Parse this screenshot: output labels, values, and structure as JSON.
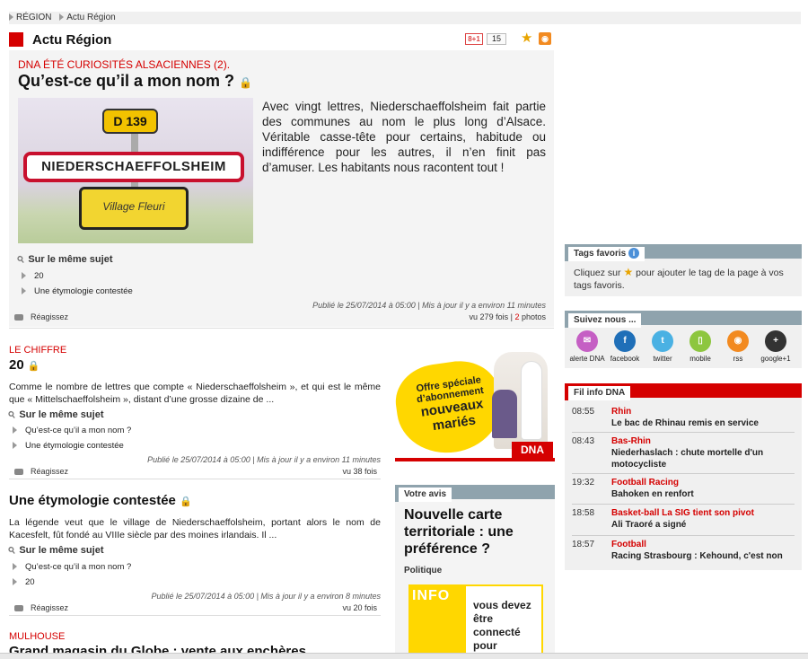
{
  "breadcrumb": {
    "items": [
      "RÉGION",
      "Actu Région"
    ]
  },
  "section": {
    "title": "Actu Région",
    "gplus_label": "8+1",
    "gplus_count": "15"
  },
  "lead": {
    "kicker": "DNA ÉTÉ CURIOSITÉS ALSACIENNES (2).",
    "title": "Qu’est-ce qu’il a mon nom ?",
    "image": {
      "road_number": "D 139",
      "sign_text": "NIEDERSCHAEFFOLSHEIM",
      "village_label": "Village Fleuri"
    },
    "text": "Avec vingt lettres, Niederschaeffolsheim fait partie des communes au nom le plus long d’Alsace. Véritable casse-tête pour certains, habitude ou indifférence pour les autres, il n’en finit pas d’amuser. Les habitants nous racontent tout !",
    "same_topic": "Sur le même sujet",
    "related": [
      "20",
      "Une étymologie contestée"
    ],
    "meta": "Publié le 25/07/2014 à 05:00 | Mis à jour il y a environ 11 minutes",
    "react": "Réagissez",
    "views_prefix": "vu 279 fois |",
    "photos_count": "2",
    "photos_label": "photos"
  },
  "article2": {
    "kicker": "LE CHIFFRE",
    "title": "20",
    "text": "Comme le nombre de lettres que compte « Niederschaeffolsheim », et qui est le même que « Mittelschaeffolsheim », distant d’une grosse dizaine de ...",
    "same_topic": "Sur le même sujet",
    "related": [
      "Qu’est-ce qu’il a mon nom ?",
      "Une étymologie contestée"
    ],
    "meta": "Publié le 25/07/2014 à 05:00 | Mis à jour il y a environ 11 minutes",
    "react": "Réagissez",
    "views": "vu 38 fois"
  },
  "article3": {
    "title": "Une étymologie contestée",
    "text": "La légende veut que le village de Niederschaeffolsheim, portant alors le nom de Kacesfelt, fût fondé au VIIIe siècle par des moines irlandais. Il ...",
    "same_topic": "Sur le même sujet",
    "related": [
      "Qu’est-ce qu’il a mon nom ?",
      "20"
    ],
    "meta": "Publié le 25/07/2014 à 05:00 | Mis à jour il y a environ 8 minutes",
    "react": "Réagissez",
    "views": "vu 20 fois"
  },
  "article4": {
    "kicker": "MULHOUSE",
    "title": "Grand magasin du Globe : vente aux enchères"
  },
  "promo": {
    "line1": "Offre spéciale",
    "line2": "d’abonnement",
    "line3": "nouveaux",
    "line4": "mariés",
    "brand": "DNA"
  },
  "vote": {
    "header": "Votre avis",
    "title": "Nouvelle carte territoriale : une préférence ?",
    "category": "Politique",
    "info_label": "INFO",
    "info_msg": "vous devez être connecté pour"
  },
  "tags": {
    "header": "Tags favoris",
    "text_before": "Cliquez sur",
    "text_after": "pour ajouter le tag de la page à vos tags favoris."
  },
  "follow": {
    "header": "Suivez nous ...",
    "items": [
      {
        "label": "alerte DNA",
        "icon": "alert-icon",
        "color": "#c55fc4",
        "glyph": "✉"
      },
      {
        "label": "facebook",
        "icon": "facebook-icon",
        "color": "#1f6fb8",
        "glyph": "f"
      },
      {
        "label": "twitter",
        "icon": "twitter-icon",
        "color": "#4ab1e3",
        "glyph": "t"
      },
      {
        "label": "mobile",
        "icon": "mobile-icon",
        "color": "#8dc63f",
        "glyph": "▯"
      },
      {
        "label": "rss",
        "icon": "rss-icon",
        "color": "#f28a20",
        "glyph": "◉"
      },
      {
        "label": "google+1",
        "icon": "googleplus-icon",
        "color": "#333333",
        "glyph": "+"
      }
    ]
  },
  "fil": {
    "header": "Fil info DNA",
    "items": [
      {
        "time": "08:55",
        "cat": "Rhin",
        "headline": "Le bac de Rhinau remis en service"
      },
      {
        "time": "08:43",
        "cat": "Bas-Rhin",
        "headline": "Niederhaslach : chute mortelle d'un motocycliste"
      },
      {
        "time": "19:32",
        "cat": "Football Racing",
        "headline": "Bahoken en renfort"
      },
      {
        "time": "18:58",
        "cat": "Basket-ball La SIG tient son pivot",
        "headline": "Ali Traoré a signé"
      },
      {
        "time": "18:57",
        "cat": "Football",
        "headline": "Racing Strasbourg : Kehound, c'est non"
      }
    ]
  },
  "colors": {
    "accent": "#d50000",
    "grey_bar": "#8fa3ad",
    "gold": "#ffd700"
  }
}
